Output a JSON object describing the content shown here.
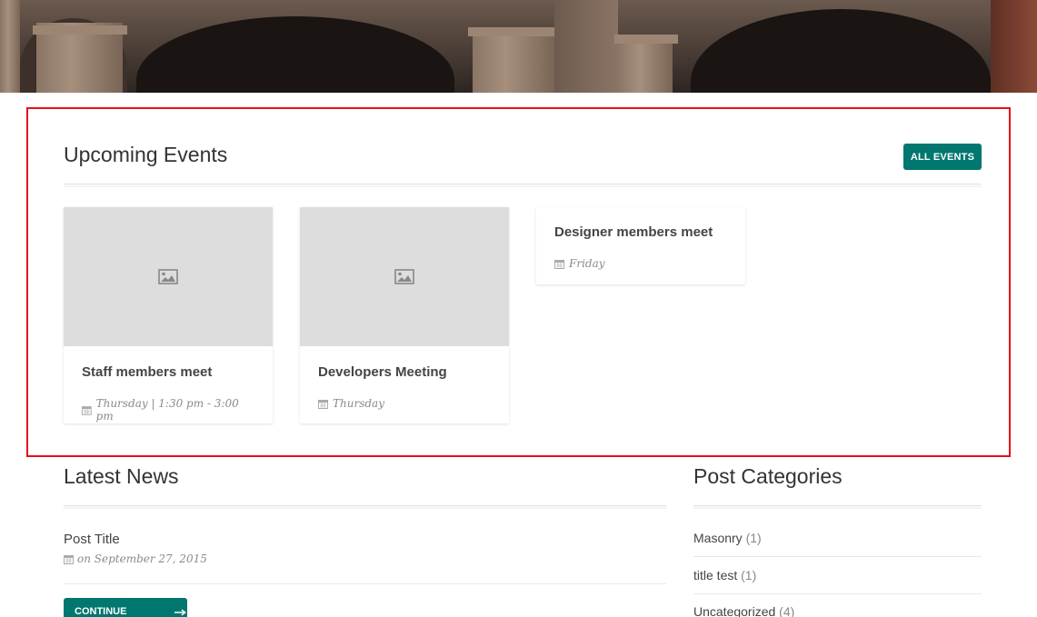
{
  "events": {
    "heading": "Upcoming Events",
    "all_button": "ALL EVENTS",
    "items": [
      {
        "title": "Staff members meet",
        "meta": "Thursday | 1:30 pm - 3:00 pm",
        "has_image": true
      },
      {
        "title": "Developers Meeting",
        "meta": "Thursday",
        "has_image": true
      },
      {
        "title": "Designer members meet",
        "meta": "Friday",
        "has_image": false
      }
    ]
  },
  "news": {
    "heading": "Latest News",
    "post_title": "Post Title",
    "post_meta": "on September 27, 2015",
    "continue_label": "CONTINUE READING"
  },
  "categories": {
    "heading": "Post Categories",
    "items": [
      {
        "name": "Masonry",
        "count": "(1)"
      },
      {
        "name": "title test",
        "count": "(1)"
      },
      {
        "name": "Uncategorized",
        "count": "(4)"
      }
    ]
  },
  "colors": {
    "accent": "#00776f",
    "highlight_border": "#e3101b",
    "placeholder_bg": "#dddddd"
  },
  "icons": {
    "placeholder": "image-icon",
    "date": "calendar-icon",
    "arrow": "arrow-right-icon"
  }
}
